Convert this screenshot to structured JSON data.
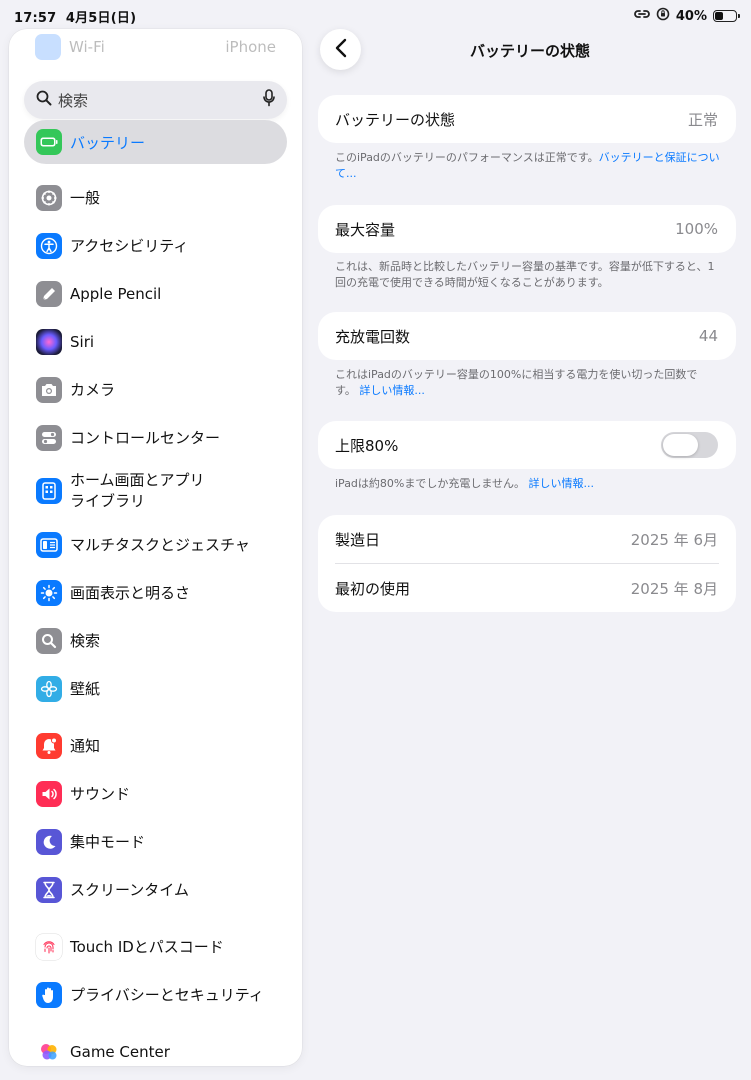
{
  "status_bar": {
    "time": "17:57",
    "date": "4月5日(日)",
    "battery": "40%",
    "battery_level": 0.4
  },
  "sidebar": {
    "ghost_item": {
      "label": "Wi-Fi",
      "value": "iPhone"
    },
    "search": {
      "placeholder": "検索"
    },
    "selected": {
      "label": "バッテリー"
    },
    "items": [
      {
        "label": "一般",
        "icon": "gear-icon",
        "color": "#8e8e93"
      },
      {
        "label": "アクセシビリティ",
        "icon": "accessibility-icon",
        "color": "#0a7aff"
      },
      {
        "label": "Apple Pencil",
        "icon": "pencil-icon",
        "color": "#8e8e93"
      },
      {
        "label": "Siri",
        "icon": "siri-icon",
        "color": "#1c1c3a"
      },
      {
        "label": "カメラ",
        "icon": "camera-icon",
        "color": "#8e8e93"
      },
      {
        "label": "コントロールセンター",
        "icon": "control-center-icon",
        "color": "#8e8e93"
      },
      {
        "label": "ホーム画面とアプリ\nライブラリ",
        "icon": "home-screen-icon",
        "color": "#0a7aff"
      },
      {
        "label": "マルチタスクとジェスチャ",
        "icon": "multitasking-icon",
        "color": "#0a7aff"
      },
      {
        "label": "画面表示と明るさ",
        "icon": "brightness-icon",
        "color": "#0a7aff"
      },
      {
        "label": "検索",
        "icon": "search-icon",
        "color": "#8e8e93"
      },
      {
        "label": "壁紙",
        "icon": "wallpaper-icon",
        "color": "#32ade6"
      },
      {
        "label": "通知",
        "icon": "notification-icon",
        "color": "#ff3b30"
      },
      {
        "label": "サウンド",
        "icon": "sound-icon",
        "color": "#ff2d55"
      },
      {
        "label": "集中モード",
        "icon": "moon-icon",
        "color": "#5856d6"
      },
      {
        "label": "スクリーンタイム",
        "icon": "hourglass-icon",
        "color": "#5856d6"
      },
      {
        "label": "Touch IDとパスコード",
        "icon": "fingerprint-icon",
        "color": "#ffffff"
      },
      {
        "label": "プライバシーとセキュリティ",
        "icon": "hand-icon",
        "color": "#0a7aff"
      },
      {
        "label": "Game Center",
        "icon": "game-center-icon",
        "color": "#ffffff"
      }
    ]
  },
  "detail": {
    "title": "バッテリーの状態",
    "state": {
      "label": "バッテリーの状態",
      "value": "正常"
    },
    "state_note": {
      "text": "このiPadのバッテリーのパフォーマンスは正常です。",
      "link": "バッテリーと保証について..."
    },
    "capacity": {
      "label": "最大容量",
      "value": "100%"
    },
    "capacity_note": {
      "text": "これは、新品時と比較したバッテリー容量の基準です。容量が低下すると、1回の充電で使用できる時間が短くなることがあります。"
    },
    "cycles": {
      "label": "充放電回数",
      "value": "44"
    },
    "cycles_note": {
      "text": "これはiPadのバッテリー容量の100%に相当する電力を使い切った回数です。",
      "link": "詳しい情報..."
    },
    "limit": {
      "label": "上限80%",
      "enabled": false
    },
    "limit_note": {
      "text": "iPadは約80%までしか充電しません。",
      "link": "詳しい情報..."
    },
    "manufacture": {
      "label": "製造日",
      "value": "2025 年 6月"
    },
    "first_use": {
      "label": "最初の使用",
      "value": "2025 年 8月"
    }
  }
}
